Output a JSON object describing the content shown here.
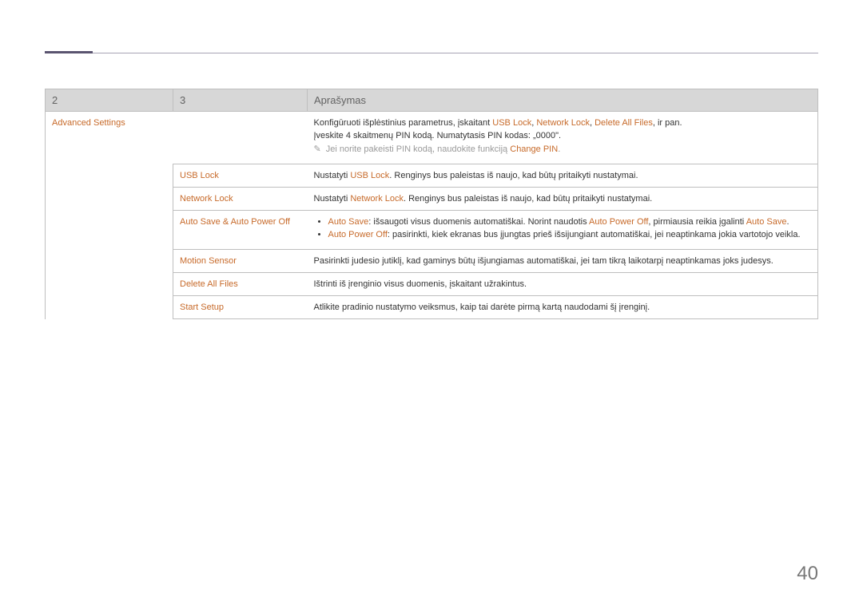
{
  "header": {
    "col_2": "2",
    "col_3": "3",
    "col_desc": "Aprašymas"
  },
  "page_number": "40",
  "rows": {
    "adv": {
      "level2": "Advanced Settings",
      "desc_p1_pre": "Konfigūruoti išplėstinius parametrus, įskaitant ",
      "desc_usb": "USB Lock",
      "desc_sep1": ", ",
      "desc_net": "Network Lock",
      "desc_sep2": ", ",
      "desc_del": "Delete All Files",
      "desc_suffix": ", ir pan.",
      "desc_p2": "Įveskite 4 skaitmenų PIN kodą. Numatytasis PIN kodas: „0000\".",
      "note_pre": "Jei norite pakeisti PIN kodą, naudokite funkciją ",
      "note_link": "Change PIN",
      "note_dot": "."
    },
    "usb": {
      "level3": "USB Lock",
      "desc_pre": "Nustatyti ",
      "desc_link": "USB Lock",
      "desc_post": ". Renginys bus paleistas iš naujo, kad būtų pritaikyti nustatymai."
    },
    "net": {
      "level3": "Network Lock",
      "desc_pre": "Nustatyti ",
      "desc_link": "Network Lock",
      "desc_post": ". Renginys bus paleistas iš naujo, kad būtų pritaikyti nustatymai."
    },
    "auto": {
      "level3": "Auto Save & Auto Power Off",
      "li1_link": "Auto Save",
      "li1_mid": ": išsaugoti visus duomenis automatiškai. Norint naudotis ",
      "li1_link2": "Auto Power Off",
      "li1_mid2": ", pirmiausia reikia įgalinti ",
      "li1_link3": "Auto Save",
      "li1_end": ".",
      "li2_link": "Auto Power Off",
      "li2_rest": ": pasirinkti, kiek ekranas bus įjungtas prieš išsijungiant automatiškai, jei neaptinkama jokia vartotojo veikla."
    },
    "motion": {
      "level3": "Motion Sensor",
      "desc": "Pasirinkti judesio jutiklį, kad gaminys būtų išjungiamas automatiškai, jei tam tikrą laikotarpį neaptinkamas joks judesys."
    },
    "delete": {
      "level3": "Delete All Files",
      "desc": "Ištrinti iš įrenginio visus duomenis, įskaitant užrakintus."
    },
    "start": {
      "level3": "Start Setup",
      "desc": "Atlikite pradinio nustatymo veiksmus, kaip tai darėte pirmą kartą naudodami šį įrenginį."
    }
  }
}
